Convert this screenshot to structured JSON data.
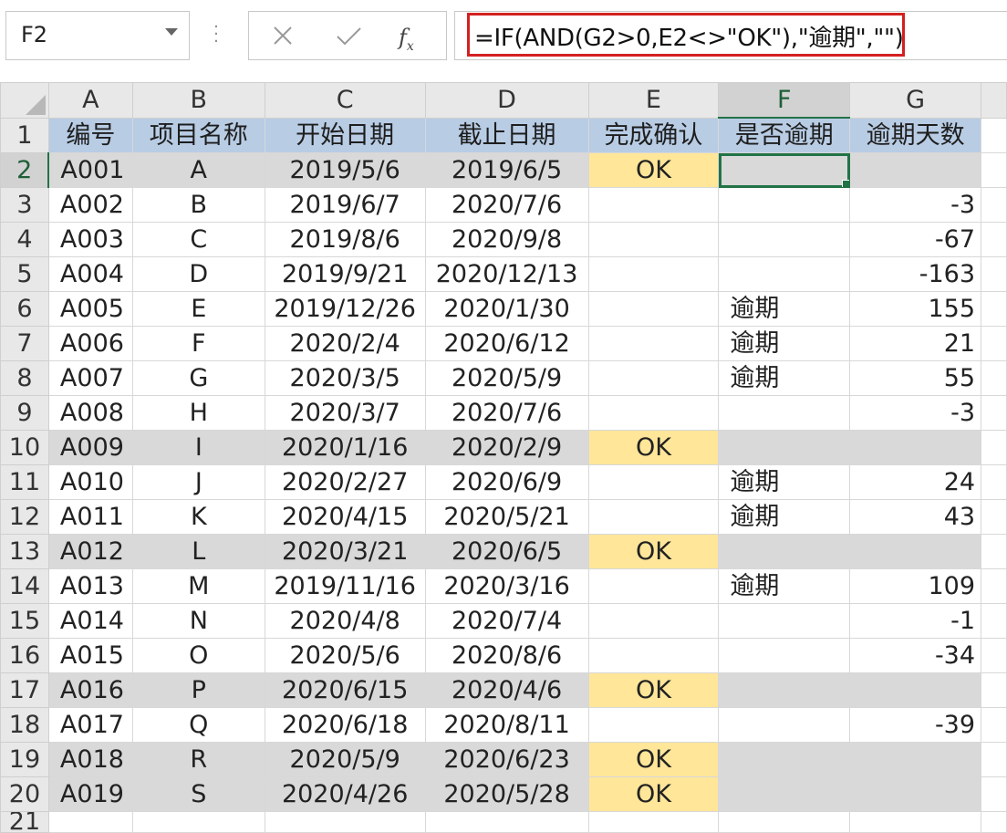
{
  "name_box": {
    "value": "F2",
    "dropdown_icon": "chevron-down-icon"
  },
  "formula_bar": {
    "cancel_icon": "close-icon",
    "enter_icon": "check-icon",
    "fx_label": "fx",
    "formula": "=IF(AND(G2>0,E2<>\"OK\"),\"逾期\",\"\")",
    "highlight_color": "#d42020"
  },
  "sheet": {
    "selected_cell": "F2",
    "columns": [
      "A",
      "B",
      "C",
      "D",
      "E",
      "F",
      "G"
    ],
    "header_row": {
      "number": "1",
      "labels": [
        "编号",
        "项目名称",
        "开始日期",
        "截止日期",
        "完成确认",
        "是否逾期",
        "逾期天数"
      ]
    },
    "rows": [
      {
        "n": "2",
        "id": "A001",
        "name": "A",
        "start": "2019/5/6",
        "end": "2019/6/5",
        "done": "OK",
        "overdue": "",
        "days": ""
      },
      {
        "n": "3",
        "id": "A002",
        "name": "B",
        "start": "2019/6/7",
        "end": "2020/7/6",
        "done": "",
        "overdue": "",
        "days": "-3"
      },
      {
        "n": "4",
        "id": "A003",
        "name": "C",
        "start": "2019/8/6",
        "end": "2020/9/8",
        "done": "",
        "overdue": "",
        "days": "-67"
      },
      {
        "n": "5",
        "id": "A004",
        "name": "D",
        "start": "2019/9/21",
        "end": "2020/12/13",
        "done": "",
        "overdue": "",
        "days": "-163"
      },
      {
        "n": "6",
        "id": "A005",
        "name": "E",
        "start": "2019/12/26",
        "end": "2020/1/30",
        "done": "",
        "overdue": "逾期",
        "days": "155"
      },
      {
        "n": "7",
        "id": "A006",
        "name": "F",
        "start": "2020/2/4",
        "end": "2020/6/12",
        "done": "",
        "overdue": "逾期",
        "days": "21"
      },
      {
        "n": "8",
        "id": "A007",
        "name": "G",
        "start": "2020/3/5",
        "end": "2020/5/9",
        "done": "",
        "overdue": "逾期",
        "days": "55"
      },
      {
        "n": "9",
        "id": "A008",
        "name": "H",
        "start": "2020/3/7",
        "end": "2020/7/6",
        "done": "",
        "overdue": "",
        "days": "-3"
      },
      {
        "n": "10",
        "id": "A009",
        "name": "I",
        "start": "2020/1/16",
        "end": "2020/2/9",
        "done": "OK",
        "overdue": "",
        "days": ""
      },
      {
        "n": "11",
        "id": "A010",
        "name": "J",
        "start": "2020/2/27",
        "end": "2020/6/9",
        "done": "",
        "overdue": "逾期",
        "days": "24"
      },
      {
        "n": "12",
        "id": "A011",
        "name": "K",
        "start": "2020/4/15",
        "end": "2020/5/21",
        "done": "",
        "overdue": "逾期",
        "days": "43"
      },
      {
        "n": "13",
        "id": "A012",
        "name": "L",
        "start": "2020/3/21",
        "end": "2020/6/5",
        "done": "OK",
        "overdue": "",
        "days": ""
      },
      {
        "n": "14",
        "id": "A013",
        "name": "M",
        "start": "2019/11/16",
        "end": "2020/3/16",
        "done": "",
        "overdue": "逾期",
        "days": "109"
      },
      {
        "n": "15",
        "id": "A014",
        "name": "N",
        "start": "2020/4/8",
        "end": "2020/7/4",
        "done": "",
        "overdue": "",
        "days": "-1"
      },
      {
        "n": "16",
        "id": "A015",
        "name": "O",
        "start": "2020/5/6",
        "end": "2020/8/6",
        "done": "",
        "overdue": "",
        "days": "-34"
      },
      {
        "n": "17",
        "id": "A016",
        "name": "P",
        "start": "2020/6/15",
        "end": "2020/4/6",
        "done": "OK",
        "overdue": "",
        "days": ""
      },
      {
        "n": "18",
        "id": "A017",
        "name": "Q",
        "start": "2020/6/18",
        "end": "2020/8/11",
        "done": "",
        "overdue": "",
        "days": "-39"
      },
      {
        "n": "19",
        "id": "A018",
        "name": "R",
        "start": "2020/5/9",
        "end": "2020/6/23",
        "done": "OK",
        "overdue": "",
        "days": ""
      },
      {
        "n": "20",
        "id": "A019",
        "name": "S",
        "start": "2020/4/26",
        "end": "2020/5/28",
        "done": "OK",
        "overdue": "",
        "days": ""
      }
    ],
    "next_row_number": "21",
    "colors": {
      "header_fill": "#b8cce4",
      "completed_row_fill": "#d9d9d9",
      "ok_fill": "#ffe699",
      "selection": "#217346"
    }
  }
}
